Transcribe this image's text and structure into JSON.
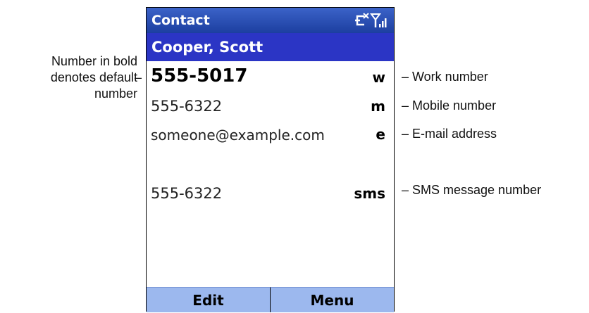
{
  "title_bar": {
    "title": "Contact",
    "status_icons": [
      "no-connection-icon",
      "signal-strength-icon"
    ]
  },
  "contact": {
    "name": "Cooper, Scott"
  },
  "details": [
    {
      "value": "555-5017",
      "code": "w",
      "is_default": true
    },
    {
      "value": "555-6322",
      "code": "m",
      "is_default": false
    },
    {
      "value": "someone@example.com",
      "code": "e",
      "is_default": false
    },
    {
      "value": "555-6322",
      "code": "sms",
      "is_default": false
    }
  ],
  "softkeys": {
    "left": "Edit",
    "right": "Menu"
  },
  "annotations": {
    "default_note": [
      "Number in bold",
      "denotes default",
      "number"
    ],
    "default_note_dash": "–",
    "work": "– Work number",
    "mobile": "– Mobile number",
    "email": "– E-mail address",
    "sms": "– SMS message number"
  },
  "colors": {
    "title_bar": "#2a4fb4",
    "name_bar": "#2b35c5",
    "softkey": "#9cb8ee"
  }
}
